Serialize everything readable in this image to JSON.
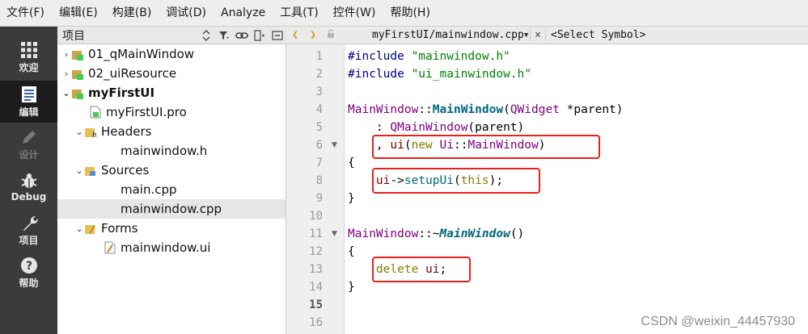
{
  "menu": [
    "文件(F)",
    "编辑(E)",
    "构建(B)",
    "调试(D)",
    "Analyze",
    "工具(T)",
    "控件(W)",
    "帮助(H)"
  ],
  "modes": [
    {
      "label": "欢迎",
      "icon": "grid-icon"
    },
    {
      "label": "编辑",
      "icon": "document-icon",
      "active": true
    },
    {
      "label": "设计",
      "icon": "pencil-icon",
      "disabled": true
    },
    {
      "label": "Debug",
      "icon": "bug-icon"
    },
    {
      "label": "项目",
      "icon": "wrench-icon"
    },
    {
      "label": "帮助",
      "icon": "help-icon"
    }
  ],
  "project_panel": {
    "title": "项目",
    "tree": [
      {
        "label": "01_qMainWindow",
        "expanded": false
      },
      {
        "label": "02_uiResource",
        "expanded": false
      },
      {
        "label": "myFirstUI",
        "expanded": true,
        "bold": true
      },
      {
        "label": "myFirstUI.pro"
      },
      {
        "label": "Headers",
        "expanded": true
      },
      {
        "label": "mainwindow.h"
      },
      {
        "label": "Sources",
        "expanded": true
      },
      {
        "label": "main.cpp"
      },
      {
        "label": "mainwindow.cpp",
        "selected": true
      },
      {
        "label": "Forms",
        "expanded": true
      },
      {
        "label": "mainwindow.ui"
      }
    ]
  },
  "editor": {
    "file": "myFirstUI/mainwindow.cpp",
    "close_symbol": "×",
    "symbol": "<Select Symbol>",
    "current_line": 15,
    "line_numbers": [
      "1",
      "2",
      "3",
      "4",
      "5",
      "6",
      "7",
      "8",
      "9",
      "10",
      "11",
      "12",
      "13",
      "14",
      "15",
      "16"
    ],
    "code": {
      "l1_a": "#include ",
      "l1_b": "\"mainwindow.h\"",
      "l2_a": "#include ",
      "l2_b": "\"ui_mainwindow.h\"",
      "l4_a": "MainWindow",
      "l4_b": "::",
      "l4_c": "MainWindow",
      "l4_d": "(",
      "l4_e": "QWidget",
      "l4_f": " *parent)",
      "l5_a": "    : ",
      "l5_b": "QMainWindow",
      "l5_c": "(parent)",
      "l6_a": "    , ",
      "l6_b": "ui",
      "l6_c": "(",
      "l6_d": "new",
      "l6_e": " ",
      "l6_f": "Ui",
      "l6_g": "::",
      "l6_h": "MainWindow",
      "l6_i": ")",
      "l7": "{",
      "l8_a": "    ",
      "l8_b": "ui",
      "l8_c": "->",
      "l8_d": "setupUi",
      "l8_e": "(",
      "l8_f": "this",
      "l8_g": ");",
      "l9": "}",
      "l11_a": "MainWindow",
      "l11_b": "::~",
      "l11_c": "MainWindow",
      "l11_d": "()",
      "l12": "{",
      "l13_a": "    ",
      "l13_b": "delete",
      "l13_c": " ",
      "l13_d": "ui",
      "l13_e": ";",
      "l14": "}"
    }
  },
  "watermark": "CSDN @weixin_44457930",
  "colors": {
    "highlight_box": "#e8211b",
    "modebar": "#3b3b3b"
  }
}
